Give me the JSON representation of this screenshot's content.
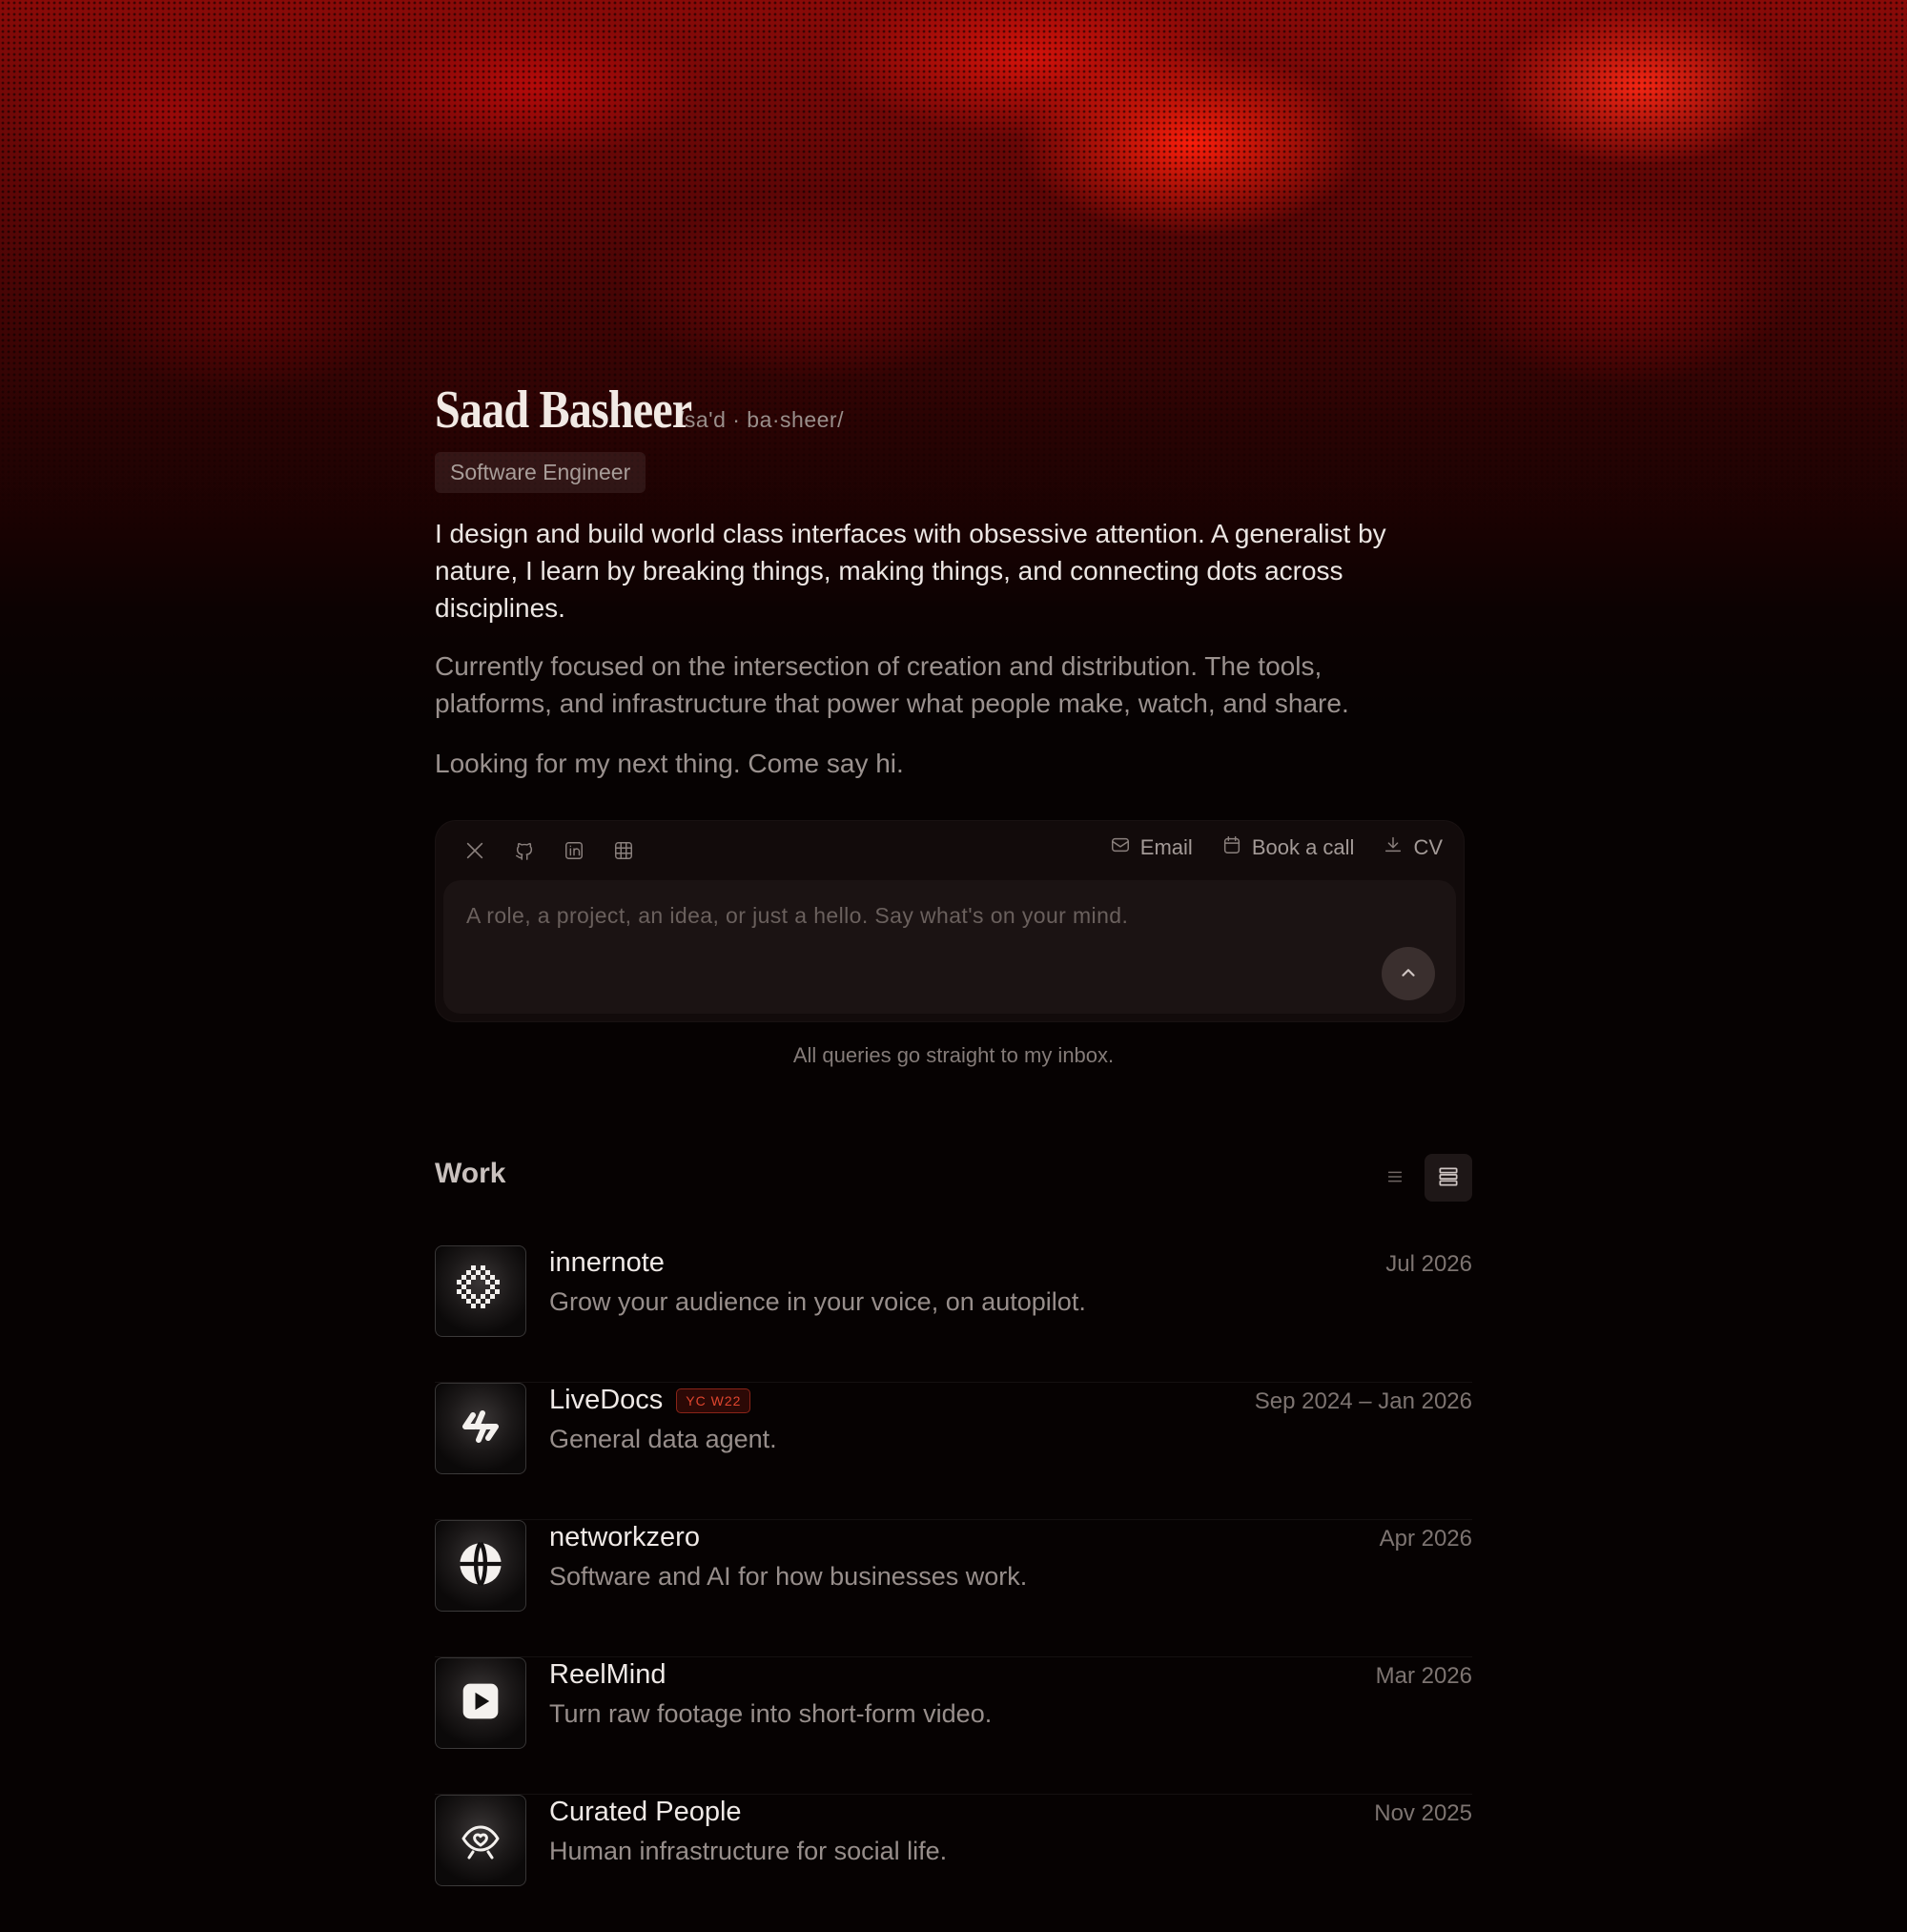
{
  "profile": {
    "name": "Saad Basheer",
    "pronunciation": "/sa'd · ba·sheer/",
    "role": "Software Engineer"
  },
  "bio": {
    "p1": "I design and build world class interfaces with obsessive attention. A generalist by nature, I learn by breaking things, making things, and connecting dots across disciplines.",
    "p2": "Currently focused on the intersection of creation and distribution. The tools, platforms, and infrastructure that power what people make, watch, and share.",
    "p3": "Looking for my next thing. Come say hi."
  },
  "contact": {
    "social_icons": [
      "x-icon",
      "github-icon",
      "linkedin-icon",
      "calendar-grid-icon"
    ],
    "actions": {
      "email_label": "Email",
      "book_call_label": "Book a call",
      "cv_label": "CV"
    },
    "message_placeholder": "A role, a project, an idea, or just a hello. Say what's on your mind.",
    "message_value": "",
    "note": "All queries go straight to my inbox."
  },
  "work": {
    "title": "Work",
    "view_mode": "detailed",
    "items": [
      {
        "name": "innernote",
        "badge": "",
        "description": "Grow your audience in your voice, on autopilot.",
        "date": "Jul 2026",
        "logo": "pixel-dots-icon"
      },
      {
        "name": "LiveDocs",
        "badge": "YC W22",
        "description": "General data agent.",
        "date": "Sep 2024 – Jan 2026",
        "logo": "bolt-swap-icon"
      },
      {
        "name": "networkzero",
        "badge": "",
        "description": "Software and AI for how businesses work.",
        "date": "Apr 2026",
        "logo": "globe-icon"
      },
      {
        "name": "ReelMind",
        "badge": "",
        "description": "Turn raw footage into short-form video.",
        "date": "Mar 2026",
        "logo": "play-icon"
      },
      {
        "name": "Curated People",
        "badge": "",
        "description": "Human infrastructure for social life.",
        "date": "Nov 2025",
        "logo": "eye-heart-icon"
      }
    ]
  },
  "theme": {
    "background": "#060202",
    "hero_red": "#e0180c",
    "badge_red": "#e0452e"
  }
}
